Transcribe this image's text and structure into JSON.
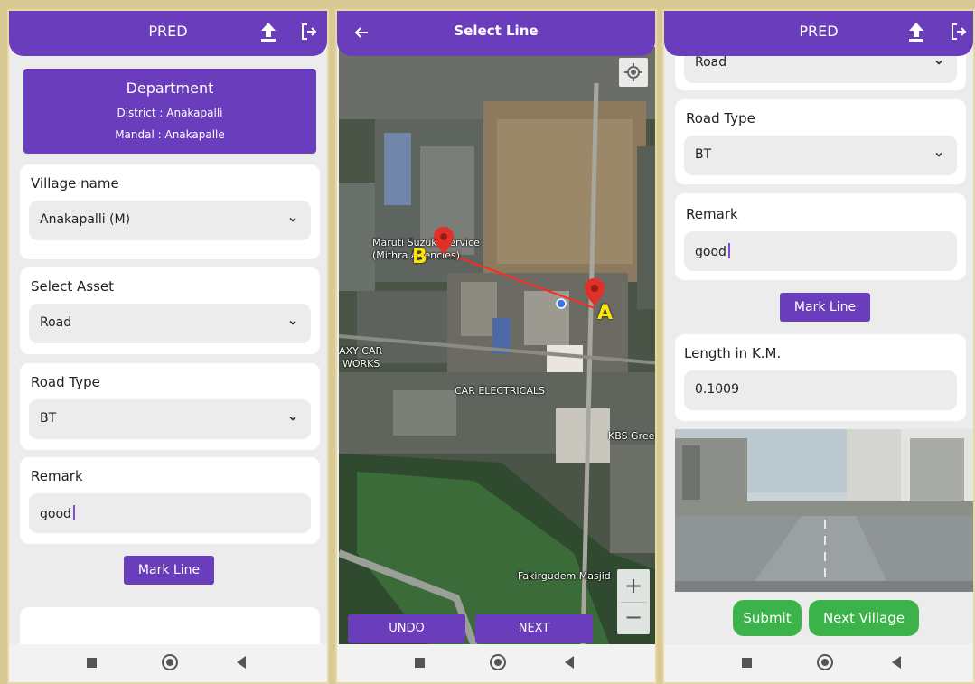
{
  "screen1": {
    "appbar": {
      "title": "PRED"
    },
    "department": {
      "title": "Department",
      "district": "District : Anakapalli",
      "mandal": "Mandal : Anakapalle"
    },
    "village": {
      "label": "Village name",
      "value": "Anakapalli (M)"
    },
    "asset": {
      "label": "Select Asset",
      "value": "Road"
    },
    "road_type": {
      "label": "Road Type",
      "value": "BT"
    },
    "remark": {
      "label": "Remark",
      "value": "good"
    },
    "mark_line_label": "Mark Line"
  },
  "screen2": {
    "appbar": {
      "title": "Select Line"
    },
    "map_labels": {
      "maruti": "Maruti Suzuki Service",
      "mithra": "(Mithra Agencies)",
      "axy": "AXY CAR",
      "works": "WORKS",
      "car_electricals": "CAR ELECTRICALS",
      "kbs": "KBS Green",
      "masjid": "Fakirgudem Masjid"
    },
    "markers": {
      "a": "A",
      "b": "B"
    },
    "zoom": {
      "plus": "+",
      "minus": "−"
    },
    "undo_label": "UNDO",
    "next_label": "NEXT"
  },
  "screen3": {
    "appbar": {
      "title": "PRED"
    },
    "asset_value": "Road",
    "road_type": {
      "label": "Road Type",
      "value": "BT"
    },
    "remark": {
      "label": "Remark",
      "value": "good"
    },
    "mark_line_label": "Mark Line",
    "length": {
      "label": "Length in K.M.",
      "value": "0.1009"
    },
    "submit_label": "Submit",
    "next_village_label": "Next Village"
  },
  "colors": {
    "primary": "#6a3dbd",
    "success": "#3cb34a",
    "marker": "#e0302a",
    "marker_label": "#ffe600"
  },
  "icons": [
    "upload-icon",
    "logout-icon",
    "back-arrow-icon",
    "chevron-down-icon",
    "my-location-icon",
    "map-pin-icon"
  ]
}
